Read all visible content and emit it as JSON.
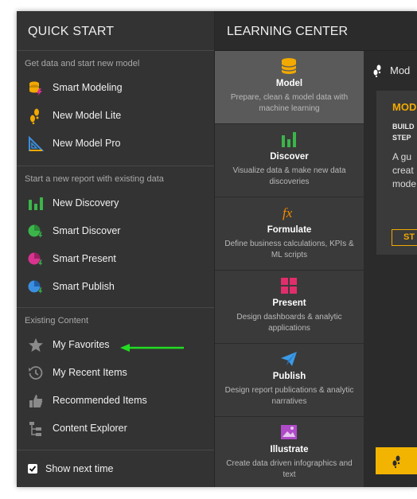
{
  "quick_start": {
    "title": "QUICK START",
    "sections": [
      {
        "header": "Get data and start new model",
        "items": [
          {
            "label": "Smart Modeling",
            "icon": "smart-modeling-icon"
          },
          {
            "label": "New Model Lite",
            "icon": "footprints-icon"
          },
          {
            "label": "New Model Pro",
            "icon": "set-square-icon"
          }
        ]
      },
      {
        "header": "Start a new report with existing data",
        "items": [
          {
            "label": "New Discovery",
            "icon": "bar-chart-icon"
          },
          {
            "label": "Smart Discover",
            "icon": "smart-discover-icon"
          },
          {
            "label": "Smart Present",
            "icon": "smart-present-icon"
          },
          {
            "label": "Smart Publish",
            "icon": "smart-publish-icon"
          }
        ]
      },
      {
        "header": "Existing Content",
        "items": [
          {
            "label": "My Favorites",
            "icon": "star-icon"
          },
          {
            "label": "My Recent Items",
            "icon": "history-icon"
          },
          {
            "label": "Recommended Items",
            "icon": "thumbs-up-icon"
          },
          {
            "label": "Content Explorer",
            "icon": "tree-icon"
          }
        ]
      }
    ],
    "show_next_time": {
      "label": "Show next time",
      "checked": true
    }
  },
  "learning_center": {
    "title": "LEARNING CENTER",
    "tiles": [
      {
        "title": "Model",
        "desc": "Prepare, clean & model data with machine learning",
        "icon": "database-icon",
        "selected": true
      },
      {
        "title": "Discover",
        "desc": "Visualize data & make new data discoveries",
        "icon": "bar-chart-icon"
      },
      {
        "title": "Formulate",
        "desc": "Define business calculations, KPIs & ML scripts",
        "icon": "fx-icon"
      },
      {
        "title": "Present",
        "desc": "Design dashboards & analytic applications",
        "icon": "dashboard-icon"
      },
      {
        "title": "Publish",
        "desc": "Design report publications & analytic narratives",
        "icon": "paper-plane-icon"
      },
      {
        "title": "Illustrate",
        "desc": "Create data driven infographics and text",
        "icon": "image-icon"
      }
    ],
    "tab_label": "Mod",
    "card": {
      "title": "MOD",
      "subtitle_1": "BUILD",
      "subtitle_2": "STEP",
      "desc_1": "A gu",
      "desc_2": "creat",
      "desc_3": "mode",
      "button": "ST"
    }
  },
  "colors": {
    "accent": "#f2a900",
    "arrow": "#22dd22",
    "panel": "#333333"
  }
}
